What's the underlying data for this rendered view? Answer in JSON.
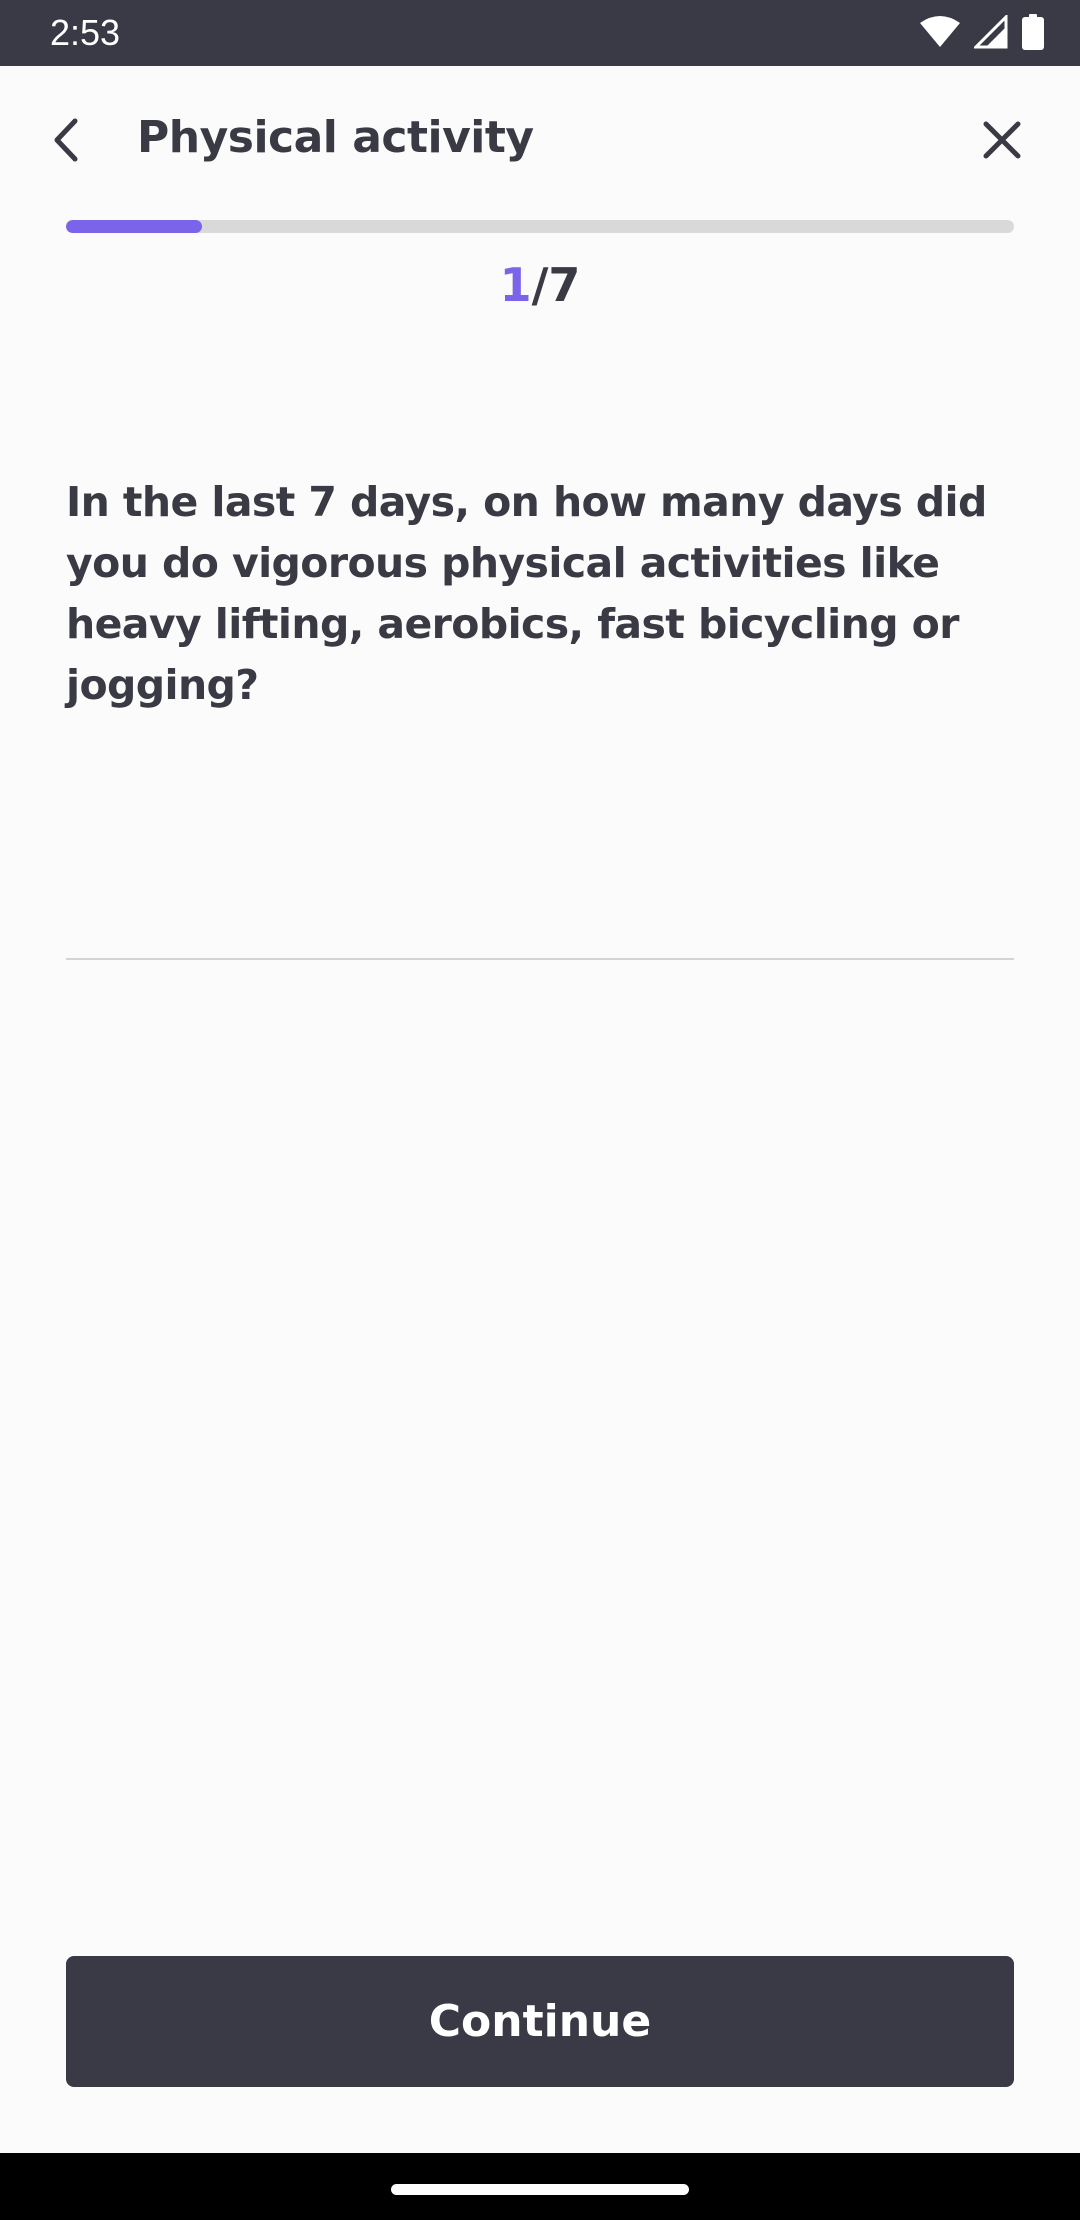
{
  "status_bar": {
    "time": "2:53",
    "icons": [
      "wifi-icon",
      "signal-icon",
      "battery-icon"
    ]
  },
  "header": {
    "title": "Physical activity",
    "back_icon": "chevron-left-icon",
    "close_icon": "close-icon"
  },
  "progress": {
    "current": "1",
    "separator_total": "/7",
    "fraction": 0.143
  },
  "question": {
    "text": "In the last 7 days, on how many days did you do vigorous physical activities like heavy lifting, aerobics, fast bicycling or jogging?"
  },
  "answer": {
    "value": "",
    "placeholder": ""
  },
  "actions": {
    "continue_label": "Continue"
  },
  "colors": {
    "accent": "#7b63ea",
    "dark": "#393a46",
    "text": "#3a3a45",
    "track": "#d9d9d9",
    "background": "#fbfbfb"
  }
}
